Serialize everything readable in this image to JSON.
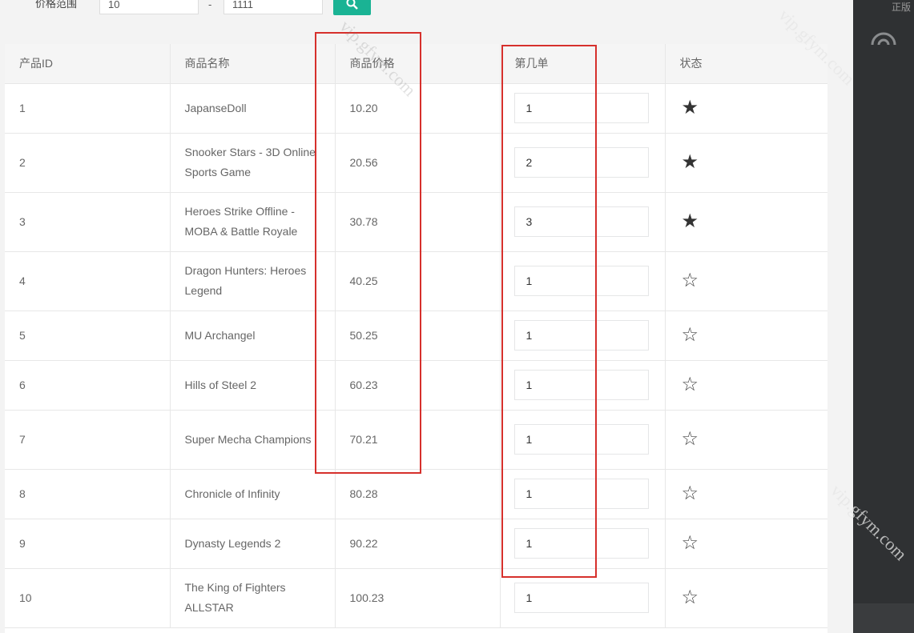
{
  "filter": {
    "label": "价格范围",
    "min_value": "10",
    "max_value": "1111",
    "dash": "-",
    "search_icon": "search-icon"
  },
  "table": {
    "headers": [
      "产品ID",
      "商品名称",
      "商品价格",
      "第几单",
      "状态"
    ],
    "rows": [
      {
        "id": "1",
        "name": "JapanseDoll",
        "price": "10.20",
        "order": "1",
        "status": "starred"
      },
      {
        "id": "2",
        "name": "Snooker Stars - 3D Online Sports Game",
        "price": "20.56",
        "order": "2",
        "status": "starred"
      },
      {
        "id": "3",
        "name": "Heroes Strike Offline - MOBA & Battle Royale",
        "price": "30.78",
        "order": "3",
        "status": "starred"
      },
      {
        "id": "4",
        "name": "Dragon Hunters: Heroes Legend",
        "price": "40.25",
        "order": "1",
        "status": "unstarred"
      },
      {
        "id": "5",
        "name": "MU Archangel",
        "price": "50.25",
        "order": "1",
        "status": "unstarred"
      },
      {
        "id": "6",
        "name": "Hills of Steel 2",
        "price": "60.23",
        "order": "1",
        "status": "unstarred"
      },
      {
        "id": "7",
        "name": "Super Mecha Champions",
        "price": "70.21",
        "order": "1",
        "status": "unstarred"
      },
      {
        "id": "8",
        "name": "Chronicle of Infinity",
        "price": "80.28",
        "order": "1",
        "status": "unstarred"
      },
      {
        "id": "9",
        "name": "Dynasty Legends 2",
        "price": "90.22",
        "order": "1",
        "status": "unstarred"
      },
      {
        "id": "10",
        "name": "The King of Fighters ALLSTAR",
        "price": "100.23",
        "order": "1",
        "status": "unstarred"
      }
    ]
  },
  "sidebar": {
    "badge": "正版",
    "icon": "copyright-icon"
  },
  "watermark": {
    "text": "vip.gfym.com"
  },
  "colors": {
    "accent": "#1ab394",
    "annotation": "#d6302c",
    "sidebar": "#2f3133"
  }
}
